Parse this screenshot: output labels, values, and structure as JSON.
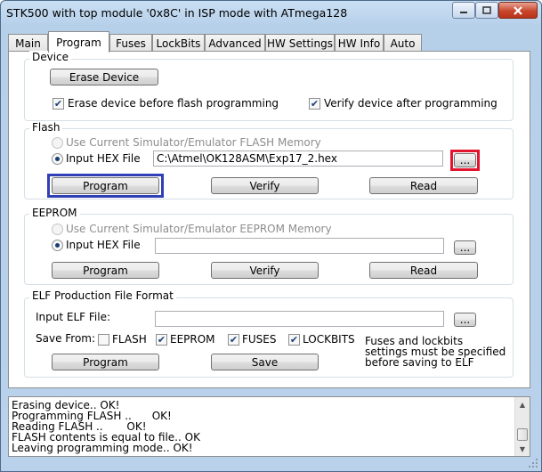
{
  "window": {
    "title": "STK500 with top module '0x8C' in ISP mode with ATmega128",
    "accent_color": "#c9dff3",
    "controls": [
      "minimize-icon",
      "maximize-icon",
      "close-icon"
    ]
  },
  "tabs": [
    {
      "label": "Main",
      "active": false
    },
    {
      "label": "Program",
      "active": true
    },
    {
      "label": "Fuses",
      "active": false
    },
    {
      "label": "LockBits",
      "active": false
    },
    {
      "label": "Advanced",
      "active": false
    },
    {
      "label": "HW Settings",
      "active": false
    },
    {
      "label": "HW Info",
      "active": false
    },
    {
      "label": "Auto",
      "active": false
    }
  ],
  "device": {
    "group_label": "Device",
    "erase_button": "Erase Device",
    "erase_before_flash": {
      "label": "Erase device before flash programming",
      "checked": true
    },
    "verify_after": {
      "label": "Verify device after programming",
      "checked": true
    }
  },
  "flash": {
    "group_label": "Flash",
    "use_simulator": {
      "label": "Use Current Simulator/Emulator FLASH Memory",
      "selected": false,
      "enabled": false
    },
    "input_hex": {
      "label": "Input HEX File",
      "selected": true
    },
    "file_path": "C:\\Atmel\\OK128ASM\\Exp17_2.hex",
    "browse": "...",
    "program": "Program",
    "verify": "Verify",
    "read": "Read",
    "highlight_colors": {
      "browse": "#e3142e",
      "program": "#2f3fb4"
    }
  },
  "eeprom": {
    "group_label": "EEPROM",
    "use_simulator": {
      "label": "Use Current Simulator/Emulator EEPROM Memory",
      "selected": false,
      "enabled": false
    },
    "input_hex": {
      "label": "Input HEX File",
      "selected": true
    },
    "file_path": "",
    "browse": "...",
    "program": "Program",
    "verify": "Verify",
    "read": "Read"
  },
  "elf": {
    "group_label": "ELF Production File Format",
    "input_label": "Input ELF File:",
    "file_path": "",
    "browse": "...",
    "save_from_label": "Save From:",
    "options": [
      {
        "label": "FLASH",
        "checked": false
      },
      {
        "label": "EEPROM",
        "checked": true
      },
      {
        "label": "FUSES",
        "checked": true
      },
      {
        "label": "LOCKBITS",
        "checked": true
      }
    ],
    "note_lines": [
      "Fuses and lockbits",
      "settings must be specified",
      "before saving to ELF"
    ],
    "program": "Program",
    "save": "Save"
  },
  "log": {
    "lines": [
      "Erasing device.. OK!",
      "Programming FLASH ..      OK!",
      "Reading FLASH ..       OK!",
      "FLASH contents is equal to file.. OK",
      "Leaving programming mode.. OK!"
    ]
  }
}
